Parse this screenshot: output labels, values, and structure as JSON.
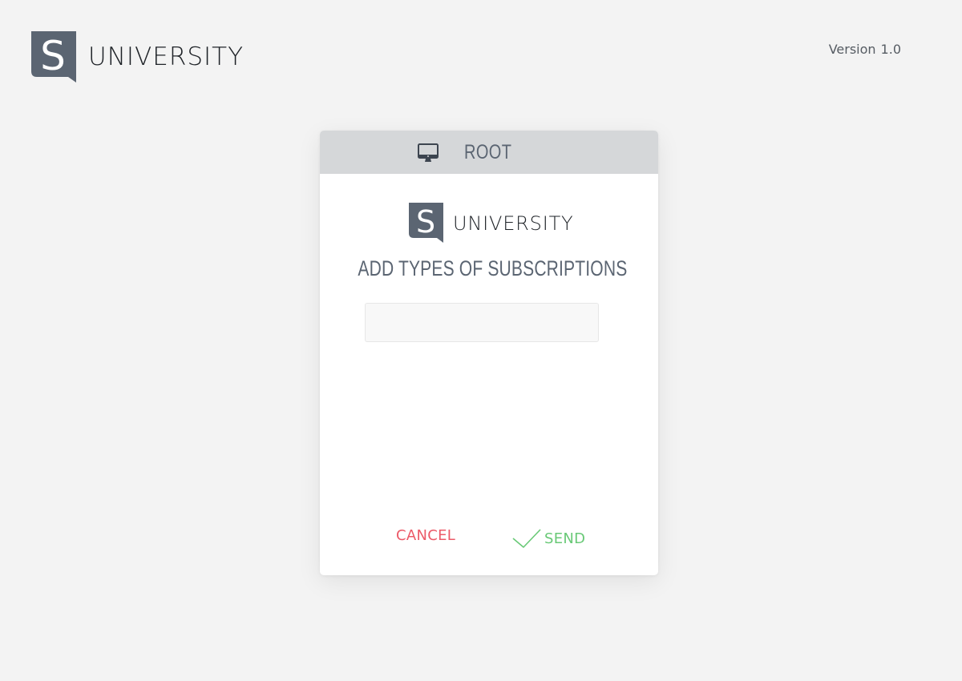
{
  "header": {
    "logo_letter": "S",
    "brand_name": "UNIVERSITY",
    "version_label": "Version",
    "version_number": "1.0"
  },
  "dialog": {
    "header_icon": "monitor-icon",
    "header_title": "ROOT",
    "logo_letter": "S",
    "brand_name": "UNIVERSITY",
    "heading": "ADD TYPES OF SUBSCRIPTIONS",
    "input_value": "",
    "input_placeholder": "",
    "cancel_label": "CANCEL",
    "send_label": "SEND",
    "send_icon": "checkmark-icon"
  },
  "colors": {
    "background": "#f3f3f3",
    "brand_slate": "#5b6572",
    "header_bar": "#d5d7d9",
    "cancel_red": "#ec5a68",
    "send_green": "#69c977"
  }
}
